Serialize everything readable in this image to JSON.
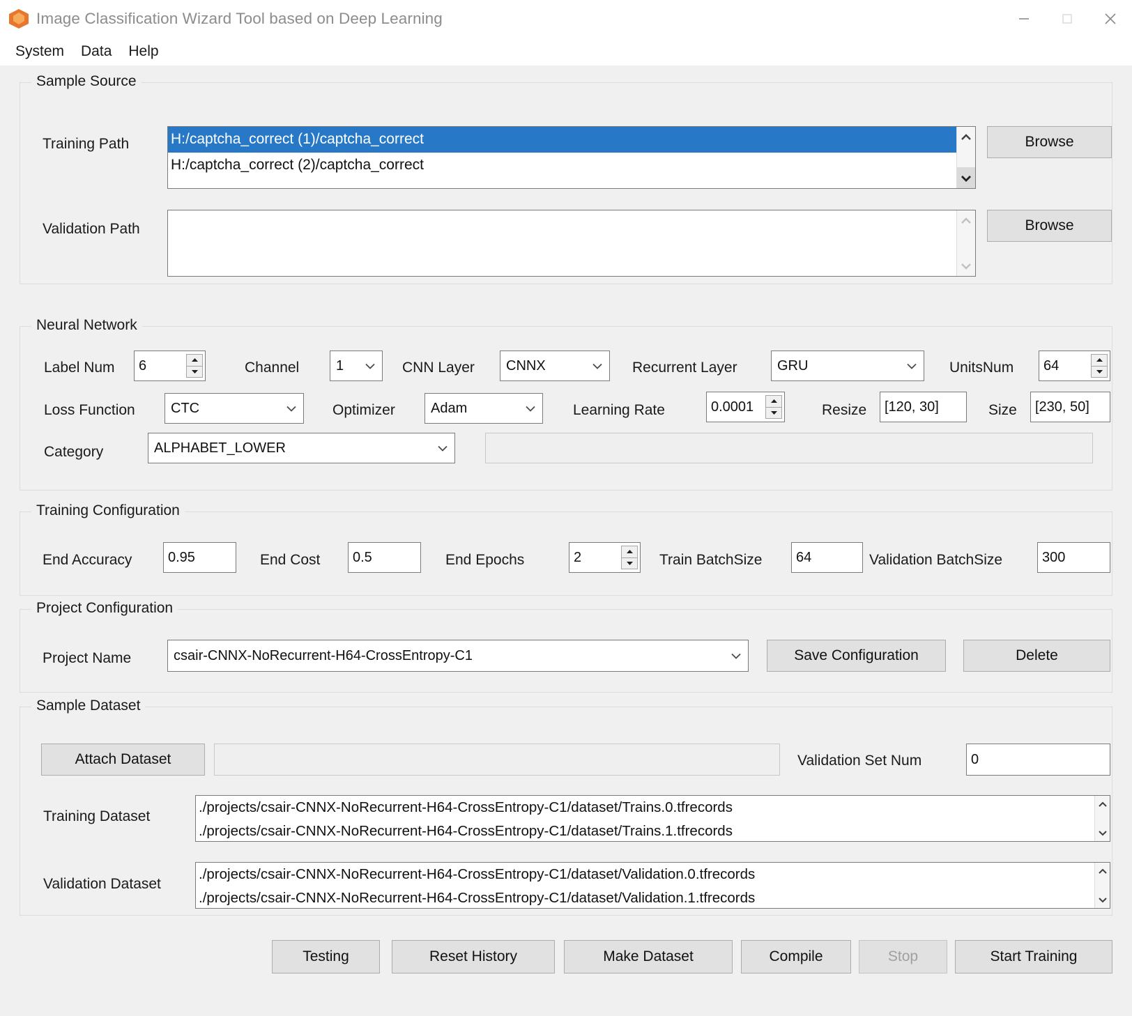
{
  "window": {
    "title": "Image Classification Wizard Tool based on Deep Learning",
    "icon": "app-hexagon-icon",
    "controls": {
      "minimize": "minimize-icon",
      "maximize": "maximize-icon",
      "close": "close-icon"
    }
  },
  "menubar": {
    "items": [
      {
        "label": "System"
      },
      {
        "label": "Data"
      },
      {
        "label": "Help"
      }
    ]
  },
  "sample_source": {
    "title": "Sample Source",
    "training_path_label": "Training Path",
    "training_path_items": [
      {
        "text": "H:/captcha_correct (1)/captcha_correct",
        "selected": true
      },
      {
        "text": "H:/captcha_correct (2)/captcha_correct",
        "selected": false
      }
    ],
    "training_browse_label": "Browse",
    "validation_path_label": "Validation Path",
    "validation_path_items": [],
    "validation_browse_label": "Browse"
  },
  "neural_network": {
    "title": "Neural Network",
    "label_num_label": "Label Num",
    "label_num_value": "6",
    "channel_label": "Channel",
    "channel_value": "1",
    "cnn_layer_label": "CNN Layer",
    "cnn_layer_value": "CNNX",
    "recurrent_layer_label": "Recurrent Layer",
    "recurrent_layer_value": "GRU",
    "units_num_label": "UnitsNum",
    "units_num_value": "64",
    "loss_function_label": "Loss Function",
    "loss_function_value": "CTC",
    "optimizer_label": "Optimizer",
    "optimizer_value": "Adam",
    "learning_rate_label": "Learning Rate",
    "learning_rate_value": "0.0001",
    "resize_label": "Resize",
    "resize_value": "[120, 30]",
    "size_label": "Size",
    "size_value": "[230, 50]",
    "category_label": "Category",
    "category_value": "ALPHABET_LOWER",
    "category_custom_value": ""
  },
  "training_configuration": {
    "title": "Training Configuration",
    "end_accuracy_label": "End Accuracy",
    "end_accuracy_value": "0.95",
    "end_cost_label": "End Cost",
    "end_cost_value": "0.5",
    "end_epochs_label": "End Epochs",
    "end_epochs_value": "2",
    "train_batchsize_label": "Train BatchSize",
    "train_batchsize_value": "64",
    "validation_batchsize_label": "Validation BatchSize",
    "validation_batchsize_value": "300"
  },
  "project_configuration": {
    "title": "Project Configuration",
    "project_name_label": "Project Name",
    "project_name_value": "csair-CNNX-NoRecurrent-H64-CrossEntropy-C1",
    "save_button": "Save Configuration",
    "delete_button": "Delete"
  },
  "sample_dataset": {
    "title": "Sample Dataset",
    "attach_button": "Attach Dataset",
    "attach_field_value": "",
    "validation_set_num_label": "Validation Set Num",
    "validation_set_num_value": "0",
    "training_dataset_label": "Training Dataset",
    "training_dataset_items": [
      "./projects/csair-CNNX-NoRecurrent-H64-CrossEntropy-C1/dataset/Trains.0.tfrecords",
      "./projects/csair-CNNX-NoRecurrent-H64-CrossEntropy-C1/dataset/Trains.1.tfrecords"
    ],
    "validation_dataset_label": "Validation Dataset",
    "validation_dataset_items": [
      "./projects/csair-CNNX-NoRecurrent-H64-CrossEntropy-C1/dataset/Validation.0.tfrecords",
      "./projects/csair-CNNX-NoRecurrent-H64-CrossEntropy-C1/dataset/Validation.1.tfrecords"
    ]
  },
  "actions": {
    "testing": "Testing",
    "reset_history": "Reset History",
    "make_dataset": "Make Dataset",
    "compile": "Compile",
    "stop": "Stop",
    "start_training": "Start Training"
  },
  "colors": {
    "selection_blue": "#2878c8",
    "window_bg": "#f0f0f0",
    "accent_orange": "#e8762c"
  }
}
